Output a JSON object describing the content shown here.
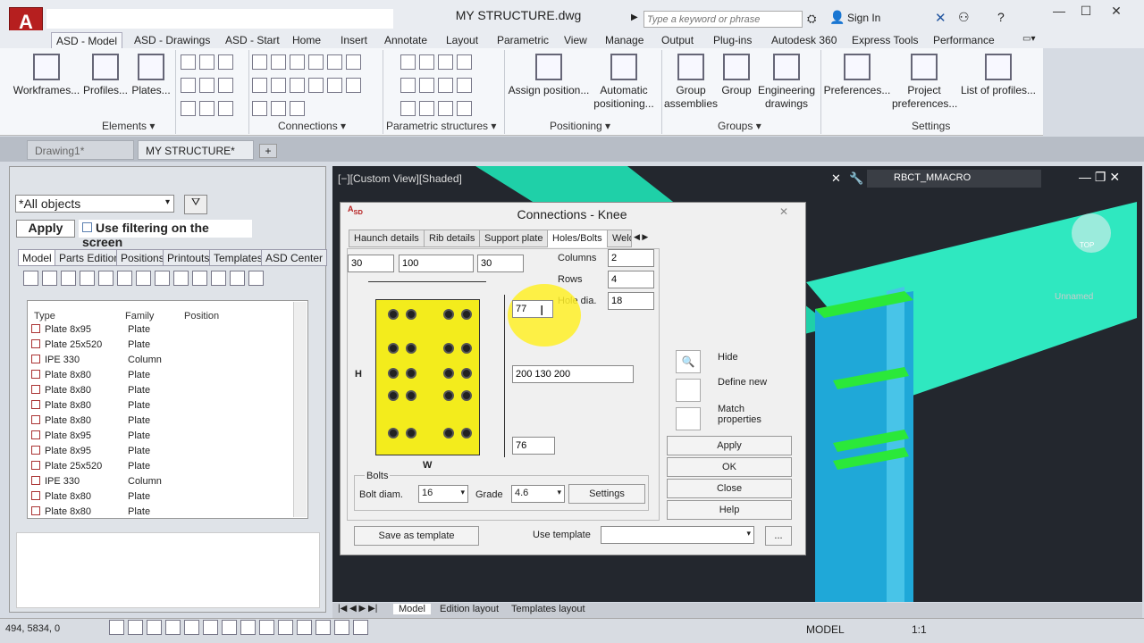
{
  "app": {
    "logo": "A",
    "logo_sub": "SD",
    "title": "MY STRUCTURE.dwg",
    "search_placeholder": "Type a keyword or phrase",
    "signin": "Sign In"
  },
  "ribbon_tabs": [
    "ASD - Model",
    "ASD - Drawings",
    "ASD - Start",
    "Home",
    "Insert",
    "Annotate",
    "Layout",
    "Parametric",
    "View",
    "Manage",
    "Output",
    "Plug-ins",
    "Autodesk 360",
    "Express Tools",
    "Performance"
  ],
  "ribbon": {
    "elements": {
      "workframes": "Workframes...",
      "profiles": "Profiles...",
      "plates": "Plates...",
      "title": "Elements"
    },
    "connections": {
      "title": "Connections"
    },
    "parametric": {
      "title": "Parametric structures"
    },
    "positioning": {
      "assign": "Assign position...",
      "automatic1": "Automatic",
      "automatic2": "positioning...",
      "title": "Positioning"
    },
    "groups": {
      "group1": "Group",
      "group2": "assemblies",
      "group": "Group",
      "eng1": "Engineering",
      "eng2": "drawings",
      "title": "Groups"
    },
    "settings": {
      "prefs": "Preferences...",
      "proj1": "Project",
      "proj2": "preferences...",
      "list": "List of profiles...",
      "title": "Settings"
    }
  },
  "doc_tabs": [
    "Drawing1*",
    "MY STRUCTURE*"
  ],
  "left_panel": {
    "filter": "*All objects",
    "apply": "Apply",
    "use_filter": "Use filtering on the screen",
    "tabs": [
      "Model",
      "Parts Edition",
      "Positions",
      "Printouts",
      "Templates",
      "ASD Center"
    ],
    "columns": [
      "Type",
      "Family",
      "Position"
    ],
    "rows": [
      [
        "Plate 8x95",
        "Plate"
      ],
      [
        "Plate 25x520",
        "Plate"
      ],
      [
        "IPE 330",
        "Column"
      ],
      [
        "Plate 8x80",
        "Plate"
      ],
      [
        "Plate 8x80",
        "Plate"
      ],
      [
        "Plate 8x80",
        "Plate"
      ],
      [
        "Plate 8x80",
        "Plate"
      ],
      [
        "Plate 8x95",
        "Plate"
      ],
      [
        "Plate 8x95",
        "Plate"
      ],
      [
        "Plate 25x520",
        "Plate"
      ],
      [
        "IPE 330",
        "Column"
      ],
      [
        "Plate 8x80",
        "Plate"
      ],
      [
        "Plate 8x80",
        "Plate"
      ]
    ]
  },
  "viewport": {
    "title": "[−][Custom View][Shaded]",
    "macro": "RBCT_MMACRO",
    "cube_top": "TOP",
    "unnamed": "Unnamed"
  },
  "dialog": {
    "title": "Connections - Knee",
    "tabs": [
      "Haunch details",
      "Rib details",
      "Support plate",
      "Holes/Bolts",
      "Weld"
    ],
    "top_inputs": [
      "30",
      "100",
      "30"
    ],
    "columns_label": "Columns",
    "columns_val": "2",
    "rows_label": "Rows",
    "rows_val": "4",
    "hole_label": "Hole dia.",
    "hole_val": "18",
    "dim_top": "77",
    "dim_mid": "200 130 200",
    "dim_bot": "76",
    "h_label": "H",
    "w_label": "W",
    "hide": "Hide",
    "define_new": "Define new",
    "match1": "Match",
    "match2": "properties",
    "apply": "Apply",
    "ok": "OK",
    "close": "Close",
    "help": "Help",
    "bolts_group": "Bolts",
    "bolt_diam_label": "Bolt diam.",
    "bolt_diam": "16",
    "grade_label": "Grade",
    "grade": "4.6",
    "settings": "Settings",
    "save_template": "Save as template",
    "use_template": "Use template",
    "ellipsis": "..."
  },
  "bottom_tabs": [
    "Model",
    "Edition layout",
    "Templates layout"
  ],
  "status": {
    "coords": "494, 5834, 0",
    "model": "MODEL",
    "scale": "1:1"
  }
}
